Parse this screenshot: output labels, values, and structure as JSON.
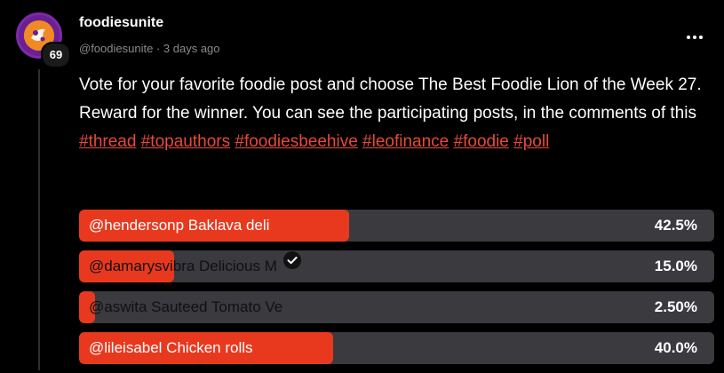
{
  "post": {
    "author": "foodiesunite",
    "reputation": "69",
    "handle": "@foodiesunite",
    "separator": "·",
    "time": "3 days ago",
    "text_parts": [
      "Vote for your favorite foodie post and choose The Best Foodie Lion of the Week 27. Reward for the winner. You can see the participating posts, in the comments of this "
    ],
    "tags": [
      "#thread",
      "#topauthors",
      "#foodiesbeehive",
      "#leofinance",
      "#foodie",
      "#poll"
    ]
  },
  "poll": {
    "options": [
      {
        "label": "@hendersonp Baklava deli",
        "percent_text": "42.5%",
        "percent": 42.5,
        "verified": false
      },
      {
        "label": "@damarysvibra Delicious M",
        "percent_text": "15.0%",
        "percent": 15.0,
        "verified": true
      },
      {
        "label": "@aswita Sauteed Tomato Ve",
        "percent_text": "2.50%",
        "percent": 2.5,
        "verified": false
      },
      {
        "label": "@lileisabel Chicken rolls",
        "percent_text": "40.0%",
        "percent": 40.0,
        "verified": false
      }
    ]
  },
  "colors": {
    "background": "#000000",
    "accent": "#e8391f",
    "tag": "#e64a3b",
    "poll_track": "#3a3a3f",
    "muted": "#8a8a8f"
  },
  "icons": {
    "more": "more-horizontal-icon",
    "verified": "verified-check-icon"
  }
}
